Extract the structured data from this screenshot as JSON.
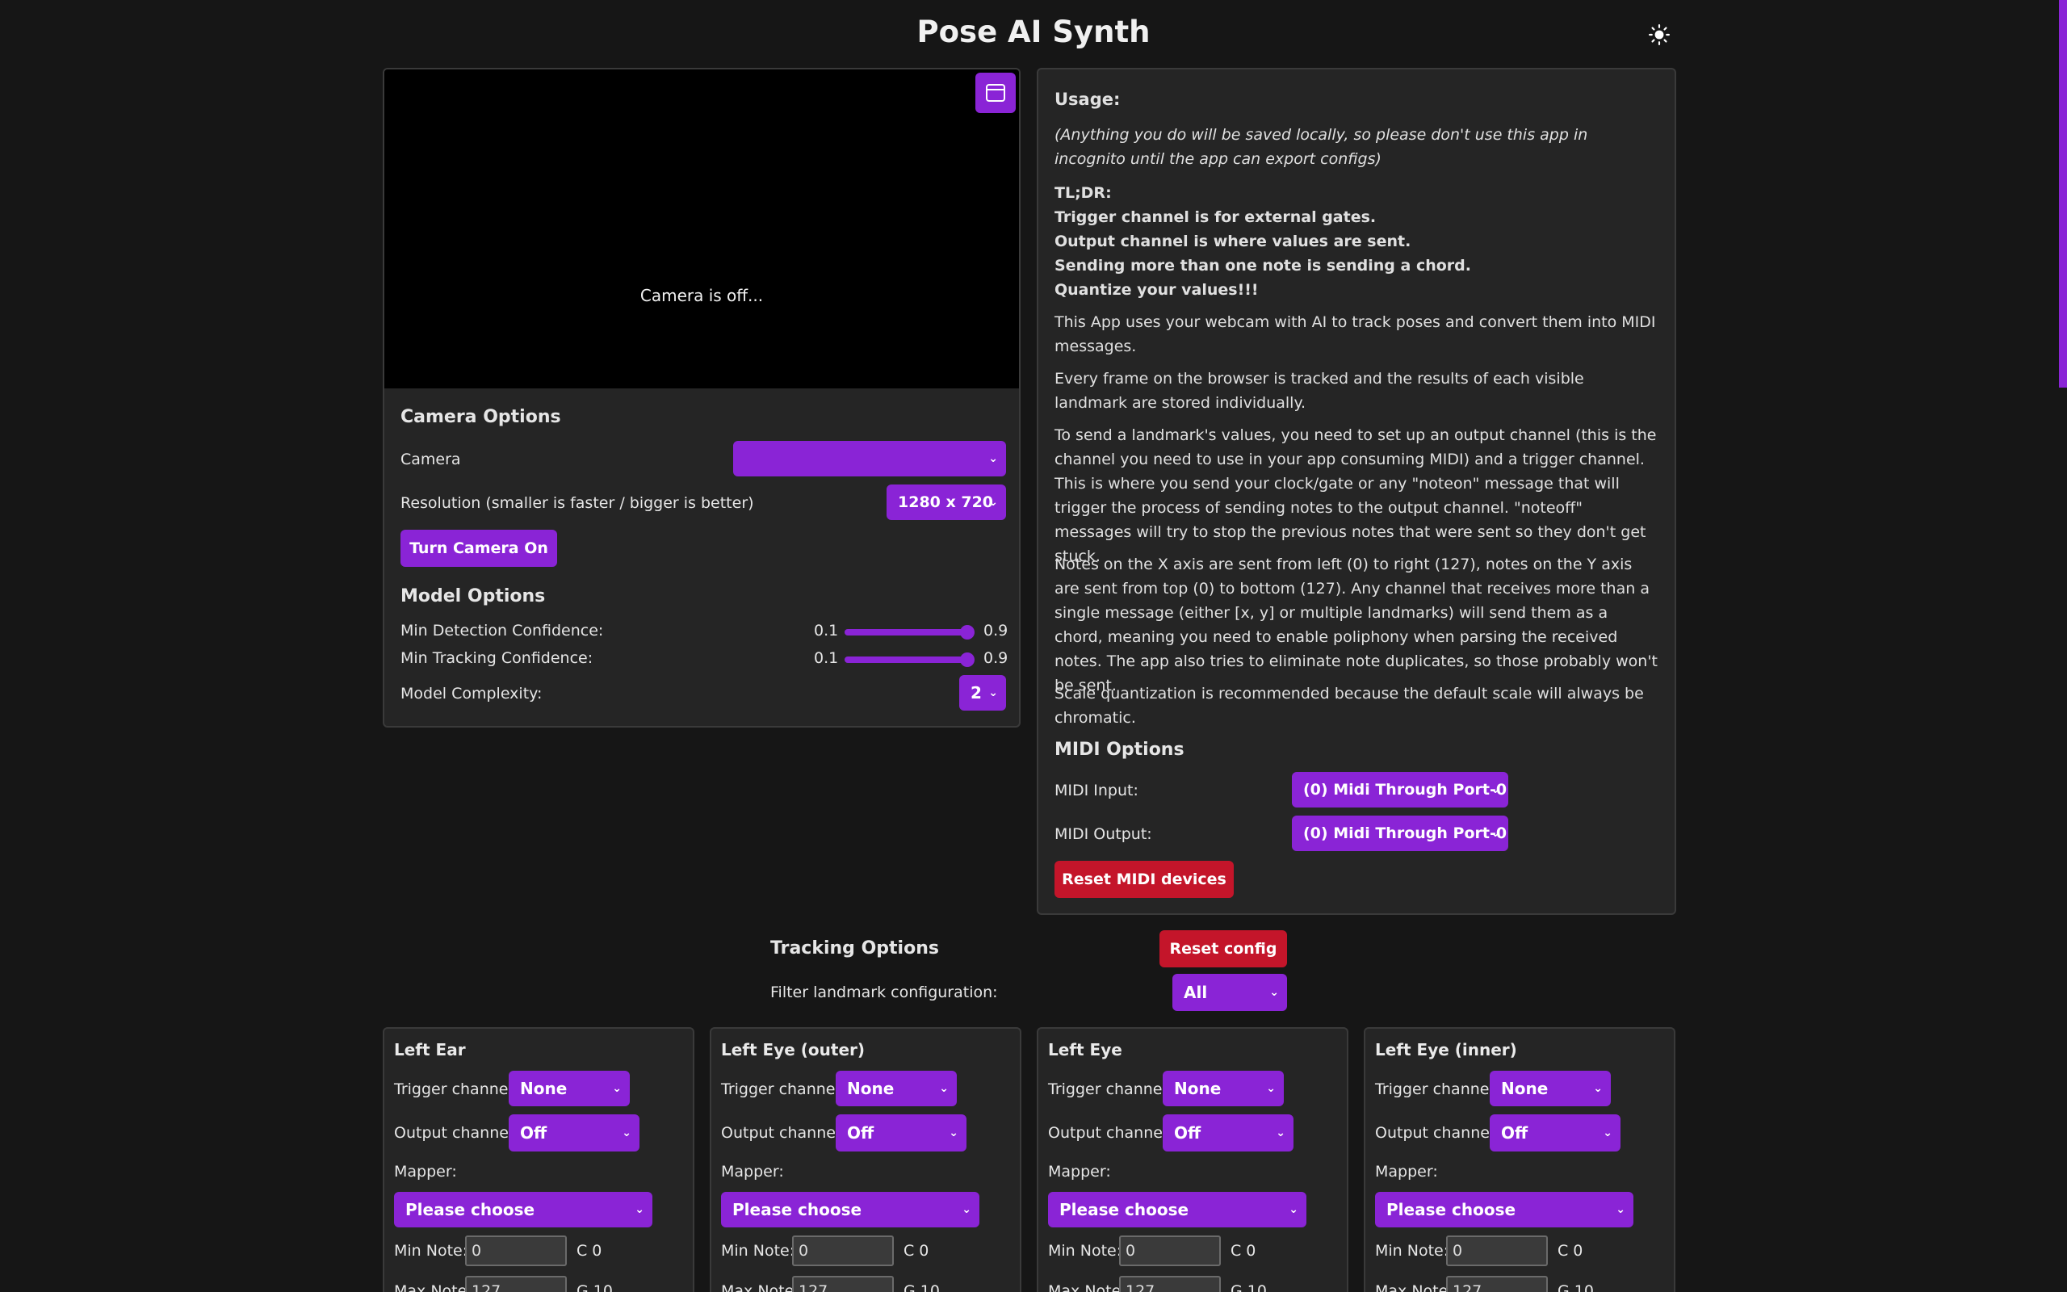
{
  "app_title": "Pose AI Synth",
  "camera": {
    "status_text": "Camera is off...",
    "options_heading": "Camera Options",
    "camera_label": "Camera",
    "camera_value": "",
    "resolution_label": "Resolution (smaller is faster / bigger is better)",
    "resolution_value": "1280 x 720",
    "turn_on_label": "Turn Camera On"
  },
  "model": {
    "heading": "Model Options",
    "min_detection_label": "Min Detection Confidence:",
    "min_detection_min": "0.1",
    "min_detection_max": "0.9",
    "min_detection_value": 0.9,
    "min_tracking_label": "Min Tracking Confidence:",
    "min_tracking_min": "0.1",
    "min_tracking_max": "0.9",
    "min_tracking_value": 0.9,
    "complexity_label": "Model Complexity:",
    "complexity_value": "2"
  },
  "usage": {
    "title": "Usage:",
    "note": "(Anything you do will be saved locally, so please don't use this app in incognito until the app can export configs)",
    "tldr_title": "TL;DR:",
    "tldr_1": "Trigger channel is for external gates.",
    "tldr_2": "Output channel is where values are sent.",
    "tldr_3": "Sending more than one note is sending a chord.",
    "tldr_4": "Quantize your values!!!",
    "p1": "This App uses your webcam with AI to track poses and convert them into MIDI messages.",
    "p2": "Every frame on the browser is tracked and the results of each visible landmark are stored individually.",
    "p3": "To send a landmark's values, you need to set up an output channel (this is the channel you need to use in your app consuming MIDI) and a trigger channel. This is where you send your clock/gate or any \"noteon\" message that will trigger the process of sending notes to the output channel. \"noteoff\" messages will try to stop the previous notes that were sent so they don't get stuck.",
    "p4": "Notes on the X axis are sent from left (0) to right (127), notes on the Y axis are sent from top (0) to bottom (127). Any channel that receives more than a single message (either [x, y] or multiple landmarks) will send them as a chord, meaning you need to enable poliphony when parsing the received notes. The app also tries to eliminate note duplicates, so those probably won't be sent.",
    "p5": "Scale quantization is recommended because the default scale will always be chromatic."
  },
  "midi": {
    "heading": "MIDI Options",
    "input_label": "MIDI Input:",
    "input_value": "(0) Midi Through Port-0",
    "output_label": "MIDI Output:",
    "output_value": "(0) Midi Through Port-0",
    "reset_label": "Reset MIDI devices"
  },
  "tracking": {
    "heading": "Tracking Options",
    "reset_config_label": "Reset config",
    "filter_label": "Filter landmark configuration:",
    "filter_value": "All"
  },
  "landmarks": [
    {
      "name": "Left Ear",
      "trigger_label": "Trigger channel:",
      "trigger_value": "None",
      "output_label": "Output channel:",
      "output_value": "Off",
      "mapper_label": "Mapper:",
      "mapper_value": "Please choose",
      "min_note_label": "Min Note:",
      "min_note_value": "0",
      "min_note_name": "C 0",
      "max_note_label": "Max Note:",
      "max_note_value": "127",
      "max_note_name": "G 10"
    },
    {
      "name": "Left Eye (outer)",
      "trigger_label": "Trigger channel:",
      "trigger_value": "None",
      "output_label": "Output channel:",
      "output_value": "Off",
      "mapper_label": "Mapper:",
      "mapper_value": "Please choose",
      "min_note_label": "Min Note:",
      "min_note_value": "0",
      "min_note_name": "C 0",
      "max_note_label": "Max Note:",
      "max_note_value": "127",
      "max_note_name": "G 10"
    },
    {
      "name": "Left Eye",
      "trigger_label": "Trigger channel:",
      "trigger_value": "None",
      "output_label": "Output channel:",
      "output_value": "Off",
      "mapper_label": "Mapper:",
      "mapper_value": "Please choose",
      "min_note_label": "Min Note:",
      "min_note_value": "0",
      "min_note_name": "C 0",
      "max_note_label": "Max Note:",
      "max_note_value": "127",
      "max_note_name": "G 10"
    },
    {
      "name": "Left Eye (inner)",
      "trigger_label": "Trigger channel:",
      "trigger_value": "None",
      "output_label": "Output channel:",
      "output_value": "Off",
      "mapper_label": "Mapper:",
      "mapper_value": "Please choose",
      "min_note_label": "Min Note:",
      "min_note_value": "0",
      "min_note_name": "C 0",
      "max_note_label": "Max Note:",
      "max_note_value": "127",
      "max_note_name": "G 10"
    }
  ],
  "colors": {
    "accent": "#8a24d6",
    "danger": "#c4152a",
    "background": "#161616",
    "panel": "#252525"
  },
  "icons": {
    "theme": "sun-icon",
    "pip": "window-icon",
    "select": "chevron-down-icon"
  }
}
